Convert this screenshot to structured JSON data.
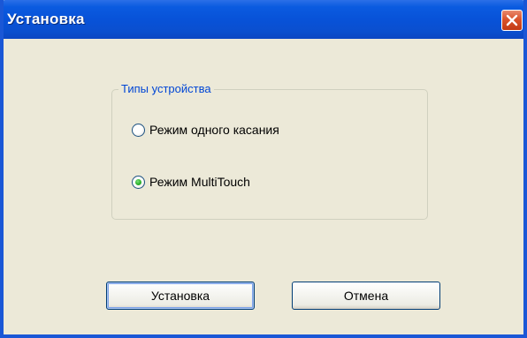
{
  "window": {
    "title": "Установка"
  },
  "titlebar": {
    "close_icon": "close-x-icon"
  },
  "device_types": {
    "legend": "Типы устройства",
    "options": [
      {
        "label": "Режим одного касания",
        "selected": false
      },
      {
        "label": "Режим MultiTouch",
        "selected": true
      }
    ]
  },
  "buttons": {
    "install_label": "Установка",
    "cancel_label": "Отмена"
  },
  "colors": {
    "titlebar": "#0852D8",
    "dialog_background": "#ECE9D8",
    "legend_text": "#0046D5",
    "close_button": "#D9532B",
    "radio_selected_dot": "#2DB22D"
  }
}
